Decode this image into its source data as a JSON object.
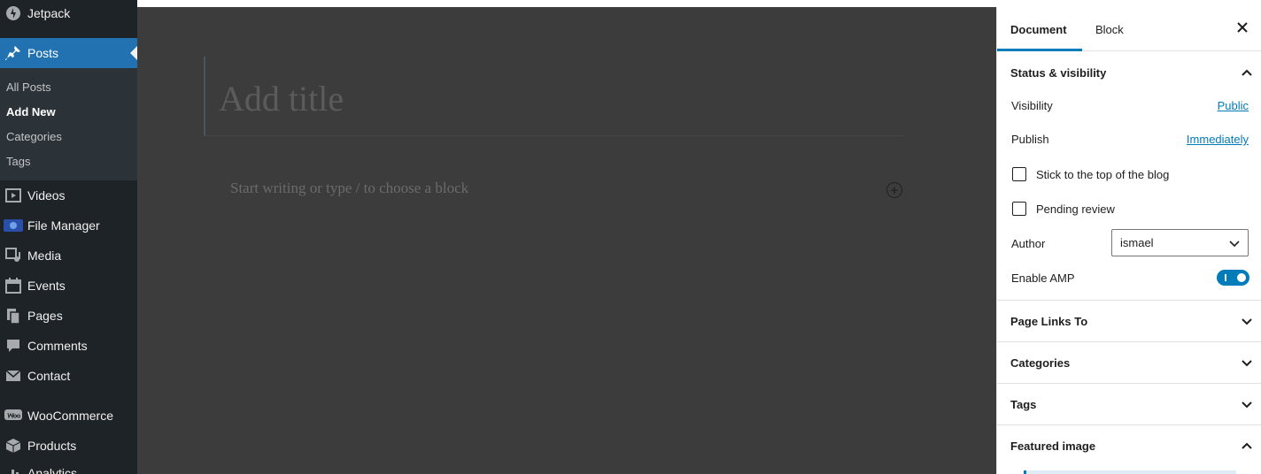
{
  "admin_menu": {
    "items": [
      {
        "label": "Jetpack",
        "icon": "jetpack-icon"
      },
      {
        "label": "Posts",
        "icon": "pin-icon"
      },
      {
        "label": "Videos",
        "icon": "video-icon"
      },
      {
        "label": "File Manager",
        "icon": "file-manager-icon"
      },
      {
        "label": "Media",
        "icon": "media-icon"
      },
      {
        "label": "Events",
        "icon": "calendar-icon"
      },
      {
        "label": "Pages",
        "icon": "pages-icon"
      },
      {
        "label": "Comments",
        "icon": "comment-icon"
      },
      {
        "label": "Contact",
        "icon": "mail-icon"
      },
      {
        "label": "WooCommerce",
        "icon": "woocommerce-icon"
      },
      {
        "label": "Products",
        "icon": "products-icon"
      },
      {
        "label": "Analytics",
        "icon": "analytics-icon"
      }
    ],
    "posts_submenu": [
      "All Posts",
      "Add New",
      "Categories",
      "Tags"
    ]
  },
  "editor": {
    "title_placeholder": "Add title",
    "body_placeholder": "Start writing or type / to choose a block"
  },
  "settings": {
    "tabs": [
      "Document",
      "Block"
    ],
    "status": {
      "heading": "Status & visibility",
      "visibility_label": "Visibility",
      "visibility_value": "Public",
      "publish_label": "Publish",
      "publish_value": "Immediately",
      "sticky_label": "Stick to the top of the blog",
      "pending_label": "Pending review",
      "author_label": "Author",
      "author_value": "ismael",
      "amp_label": "Enable AMP"
    },
    "panels": [
      "Page Links To",
      "Categories",
      "Tags",
      "Featured image"
    ]
  },
  "colors": {
    "admin_bg": "#1e2327",
    "accent": "#2271b1",
    "link": "#007cba",
    "canvas_bg": "#3c3c3c"
  }
}
